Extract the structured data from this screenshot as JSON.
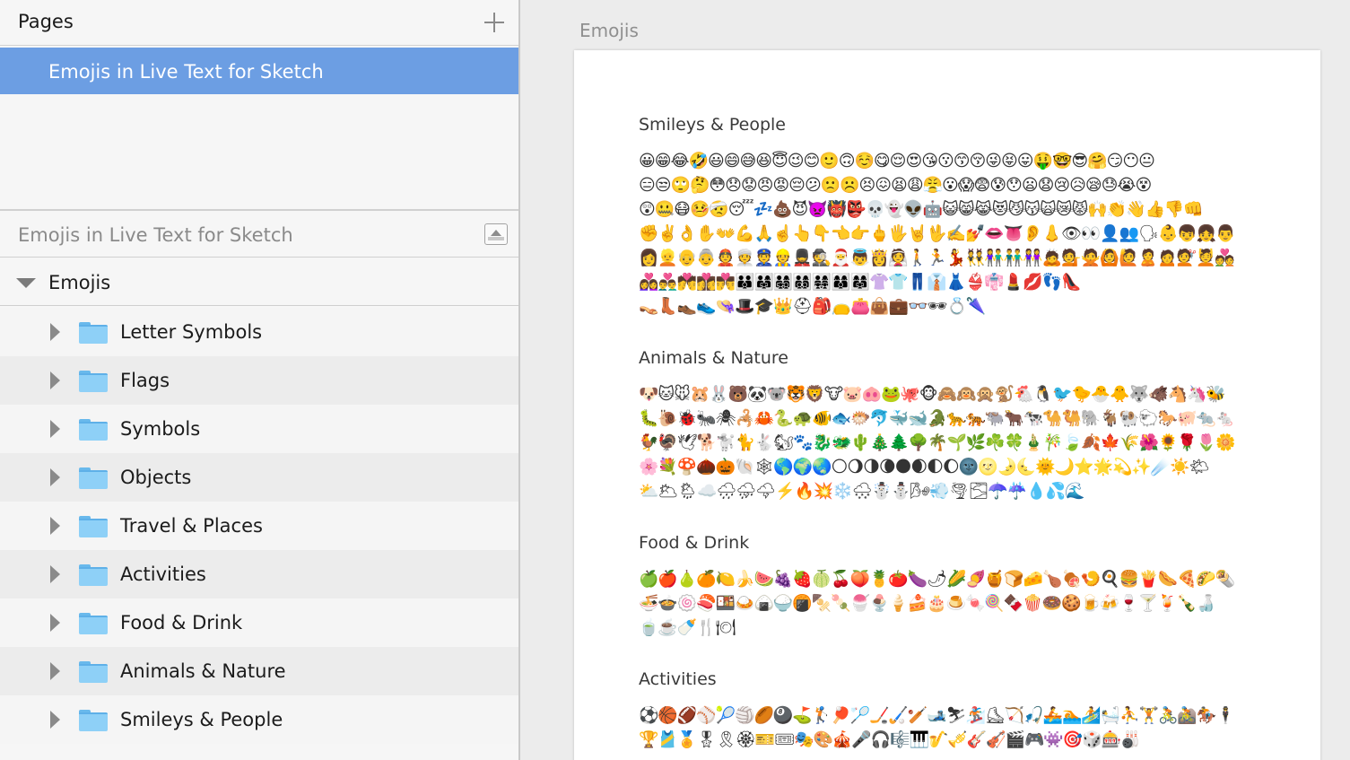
{
  "sidebar": {
    "pages_title": "Pages",
    "add_page_icon": "plus-icon",
    "page_name": "Emojis in Live Text for Sketch",
    "layers_title": "Emojis in Live Text for Sketch",
    "artboard_name": "Emojis",
    "groups": [
      {
        "label": "Letter Symbols"
      },
      {
        "label": "Flags"
      },
      {
        "label": "Symbols"
      },
      {
        "label": "Objects"
      },
      {
        "label": "Travel & Places"
      },
      {
        "label": "Activities"
      },
      {
        "label": "Food & Drink"
      },
      {
        "label": "Animals & Nature"
      },
      {
        "label": "Smileys & People"
      }
    ]
  },
  "colors": {
    "selection": "#6c9ee3",
    "folder": "#8ed0f7"
  },
  "canvas": {
    "artboard_title": "Emojis",
    "sections": [
      {
        "title": "Smileys & People",
        "lines": [
          "😀😁😂🤣😃😄😅😆😇😉😊🙂🙃☺️😋😌😍😘😗😙😚😜😝😛🤑🤓😎🤗😏😶😐",
          "😑😒🙄🤔😳😞😟😠😡😔😕🙁☹️😣😖😫😩😤😮😱😨😰😯😦😧😢😥😪😓😭😵",
          "😲🤐😷🤒🤕😴💤💩😈👿👹👺💀👻👽🤖😺😸😹😻😼😽🙀😿😾🙌👏👋👍👎👊",
          "✊✌️👌✋👐💪🙏☝️👆👇👈👉🖕🖐🤘🖖✍️💅👄👅👂👃👁👀👤👥🗣👶👦👧👨",
          "👩👱👴👵👲👳👮👷💂🕵🎅👼👸👰🚶🏃💃👯👫👬👭🙇💁🙅🙆🙋🙎🙍💇💆💑",
          "👩‍❤️‍👩👨‍❤️‍👨💏👩‍❤️‍💋‍👩👨‍❤️‍💋‍👨👪👨‍👩‍👧👨‍👩‍👧‍👦👨‍👩‍👦‍👦👨‍👩‍👧‍👧👩‍👩‍👦👩‍👩‍👧👚👕👖👔👗👙👘💄💋👣👠",
          "👡👢👞👟👒🎩🎓👑⛑🎒👝👛👜💼👓🕶💍🌂"
        ]
      },
      {
        "title": "Animals & Nature",
        "lines": [
          "🐶🐱🐭🐹🐰🐻🐼🐨🐯🦁🐮🐷🐽🐸🐙🐵🙈🙉🙊🐒🐔🐧🐦🐤🐣🐥🐺🐗🐴🦄🐝",
          "🐛🐌🐞🐜🕷🦂🦀🐍🐢🐠🐟🐡🐬🐳🐋🐊🐆🐅🐃🐂🐄🐪🐫🐘🐐🐏🐑🐎🐖🐀🐁",
          "🐓🦃🕊🐕🐩🐈🐇🐿🐾🐉🐲🌵🎄🌲🌳🌴🌱🌿☘️🍀🎍🎋🍃🍂🍁🌾🌺🌻🌹🌷🌼",
          "🌸💐🍄🌰🎃🐚🕸🌎🌍🌏🌕🌖🌗🌘🌑🌒🌓🌔🌚🌝🌛🌜🌞🌙⭐️🌟💫✨☄️☀️🌤",
          "⛅️🌥🌦☁️🌧⛈🌩⚡️🔥💥❄️🌨☃️⛄️🌬💨🌪🌫☂️☔️💧💦🌊"
        ]
      },
      {
        "title": "Food & Drink",
        "lines": [
          "🍏🍎🍐🍊🍋🍌🍉🍇🍓🍈🍒🍑🍍🍅🍆🌶🌽🍠🍯🍞🧀🍗🍖🍤🍳🍔🍟🌭🍕🌮🌯",
          "🍜🍲🍥🍣🍱🍛🍙🍚🍘🍢🍡🍧🍨🍦🍰🎂🍮🍬🍭🍫🍿🍩🍪🍺🍻🍷🍸🍹🍾🍶",
          "🍵☕️🍼🍴🍽"
        ]
      },
      {
        "title": "Activities",
        "lines": [
          "⚽️🏀🏈⚾️🎾🏐🏉🎱⛳️🏌🏓🏸🏒🏑🏏🎿⛷🏂⛸🏹🎣🚣🏊🏄🛀⛹🏋🚴🚵🏇🕴",
          "🏆🎽🏅🎖🎗🏵🎫🎟🎭🎨🎪🎤🎧🎼🎹🎷🎺🎸🎻🎬🎮👾🎯🎲🎰🎳"
        ]
      }
    ]
  }
}
